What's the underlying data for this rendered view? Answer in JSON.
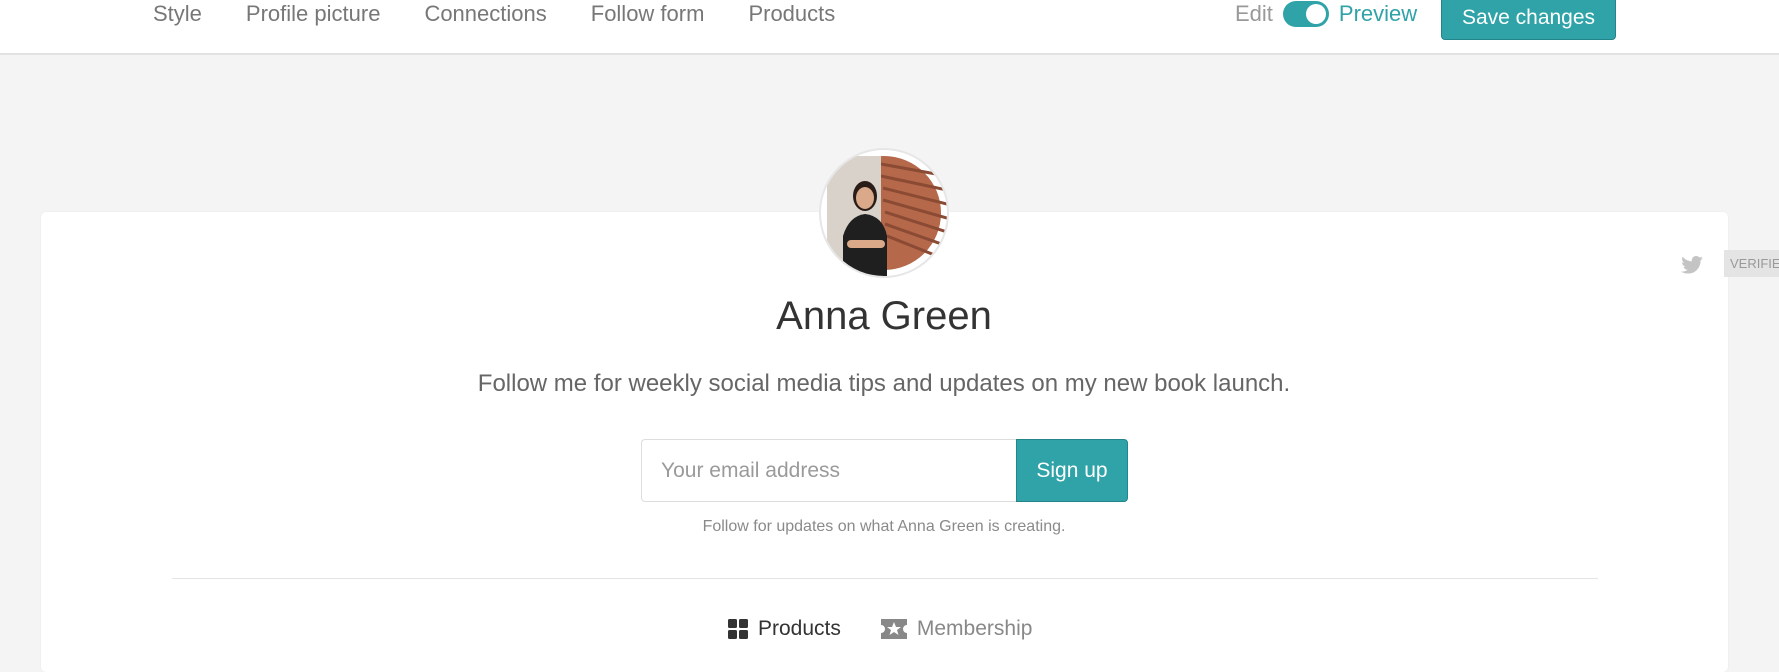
{
  "nav": {
    "tabs": [
      "Style",
      "Profile picture",
      "Connections",
      "Follow form",
      "Products"
    ]
  },
  "mode": {
    "edit_label": "Edit",
    "preview_label": "Preview",
    "preview_on": true
  },
  "toolbar": {
    "save_label": "Save changes"
  },
  "profile": {
    "name": "Anna Green",
    "bio": "Follow me for weekly social media tips and updates on my new book launch.",
    "email_placeholder": "Your email address",
    "signup_label": "Sign up",
    "follow_note": "Follow for updates on what Anna Green is creating."
  },
  "tabs": [
    {
      "label": "Products",
      "icon": "grid-icon",
      "active": true
    },
    {
      "label": "Membership",
      "icon": "ticket-star-icon",
      "active": false
    }
  ],
  "social": {
    "twitter_icon": "twitter-icon",
    "verified_label": "VERIFIED"
  },
  "colors": {
    "accent": "#2fa3a8",
    "background": "#f4f4f4"
  }
}
